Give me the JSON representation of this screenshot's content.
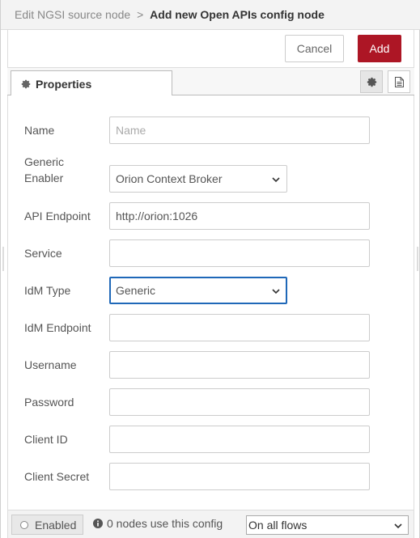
{
  "header": {
    "parent": "Edit NGSI source node",
    "separator": ">",
    "title": "Add new Open APIs config node"
  },
  "toolbar": {
    "cancel_label": "Cancel",
    "add_label": "Add"
  },
  "tabs": {
    "properties_label": "Properties",
    "icons": [
      "gear-icon",
      "document-icon"
    ]
  },
  "form": {
    "name": {
      "label": "Name",
      "value": "",
      "placeholder": "Name"
    },
    "generic_enabler": {
      "label": "Generic\nEnabler",
      "label_line1": "Generic",
      "label_line2": "Enabler",
      "value": "Orion Context Broker"
    },
    "api_endpoint": {
      "label": "API Endpoint",
      "value": "http://orion:1026"
    },
    "service": {
      "label": "Service",
      "value": ""
    },
    "idm_type": {
      "label": "IdM Type",
      "value": "Generic"
    },
    "idm_endpoint": {
      "label": "IdM Endpoint",
      "value": ""
    },
    "username": {
      "label": "Username",
      "value": ""
    },
    "password": {
      "label": "Password",
      "value": ""
    },
    "client_id": {
      "label": "Client ID",
      "value": ""
    },
    "client_secret": {
      "label": "Client Secret",
      "value": ""
    }
  },
  "footer": {
    "enabled_label": "Enabled",
    "usage_text": "0 nodes use this config",
    "scope_value": "On all flows"
  },
  "colors": {
    "add_button": "#ad1625",
    "focus_border": "#1f68b8"
  }
}
